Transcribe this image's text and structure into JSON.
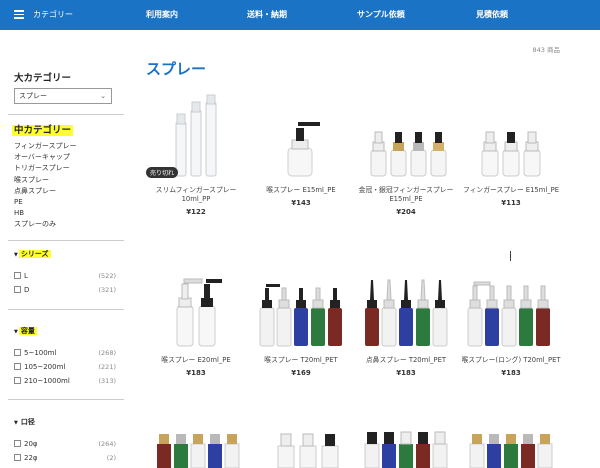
{
  "nav": {
    "category": "カテゴリー",
    "items": [
      "利用案内",
      "送料・納期",
      "サンプル依頼",
      "見積依頼"
    ]
  },
  "sidebar": {
    "major_title": "大カテゴリー",
    "major_select": "スプレー",
    "mid_title": "中カテゴリー",
    "mid_items": [
      "フィンガースプレー",
      "オーバーキャップ",
      "トリガースプレー",
      "喉スプレー",
      "点鼻スプレー",
      "PE",
      "HB",
      "スプレーのみ"
    ],
    "series": {
      "title": "シリーズ",
      "options": [
        {
          "label": "L",
          "count": "(522)"
        },
        {
          "label": "D",
          "count": "(321)"
        }
      ]
    },
    "volume": {
      "title": "容量",
      "options": [
        {
          "label": "5~100ml",
          "count": "(268)"
        },
        {
          "label": "105~200ml",
          "count": "(221)"
        },
        {
          "label": "210~1000ml",
          "count": "(313)"
        }
      ]
    },
    "mouth": {
      "title": "口径",
      "options": [
        {
          "label": "20φ",
          "count": "(264)"
        },
        {
          "label": "22φ",
          "count": "(2)"
        }
      ]
    }
  },
  "main": {
    "count": "843 商品",
    "title": "スプレー",
    "sold_out": "売り切れ",
    "products": [
      {
        "name": "スリムフィンガースプレー 10ml_PP",
        "price": "¥122"
      },
      {
        "name": "喉スプレー E15ml_PE",
        "price": "¥143"
      },
      {
        "name": "金冠・銀冠フィンガースプレー E15ml_PE",
        "price": "¥204"
      },
      {
        "name": "フィンガースプレー E15ml_PE",
        "price": "¥113"
      },
      {
        "name": "喉スプレー E20ml_PE",
        "price": "¥183"
      },
      {
        "name": "喉スプレー T20ml_PET",
        "price": "¥169"
      },
      {
        "name": "点鼻スプレー T20ml_PET",
        "price": "¥183"
      },
      {
        "name": "喉スプレー(ロング) T20ml_PET",
        "price": "¥183"
      }
    ]
  },
  "colors": {
    "nav_bg": "#1a73c4",
    "accent": "#1a73c4",
    "highlight": "#ffff2e"
  }
}
